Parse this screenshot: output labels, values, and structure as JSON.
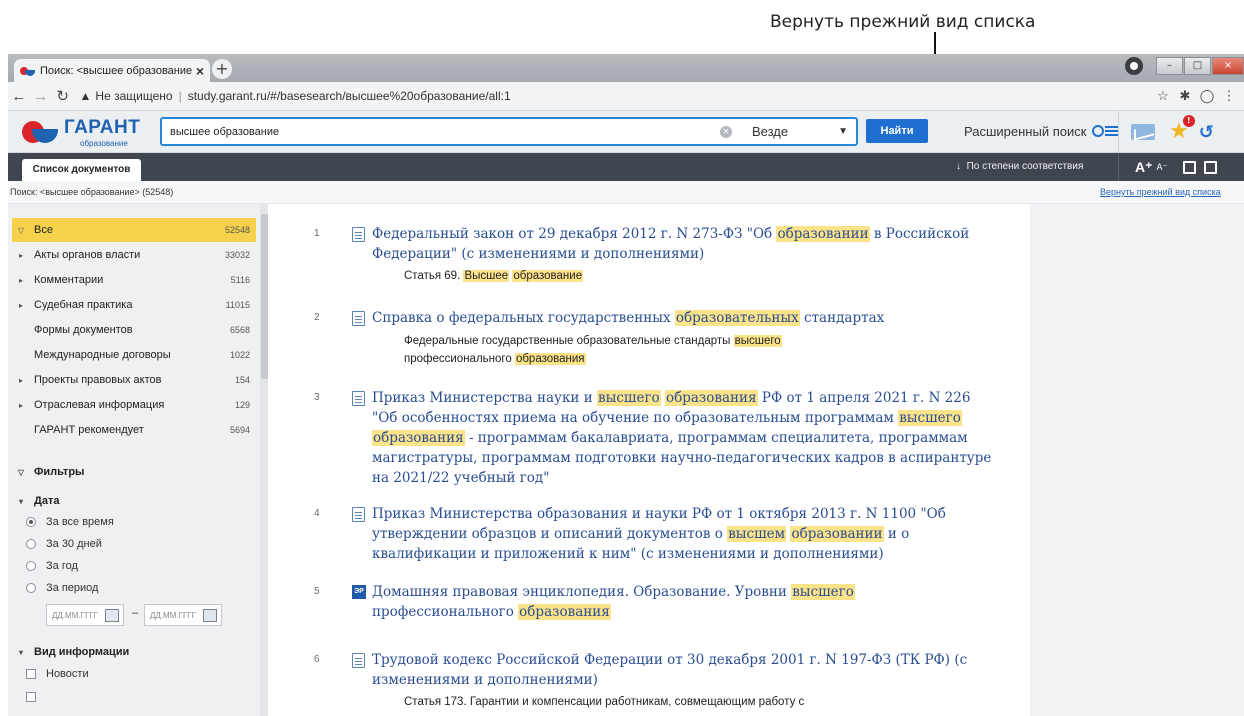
{
  "annotation": {
    "text": "Вернуть прежний вид списка"
  },
  "browser": {
    "tab_title": "Поиск: <высшее образование>",
    "new_tab": "+",
    "close_tab": "×",
    "security": "Не защищено",
    "url": "study.garant.ru/#/basesearch/высшее%20образование/all:1"
  },
  "header": {
    "logo_name": "ГАРАНТ",
    "logo_sub": "образование",
    "search_value": "высшее образование",
    "scope": "Везде",
    "find_button": "Найти",
    "advanced_search": "Расширенный поиск",
    "badge": "!"
  },
  "toolbar": {
    "doc_tab": "Список документов",
    "sort": "По степени соответствия",
    "font_up": "A⁺",
    "font_down": "A⁻"
  },
  "crumb": {
    "text": "Поиск: <высшее образование> (52548)",
    "revert_link": "Вернуть прежний вид списка"
  },
  "sidebar": {
    "categories": [
      {
        "label": "Все",
        "count": "52548"
      },
      {
        "label": "Акты органов власти",
        "count": "33032"
      },
      {
        "label": "Комментарии",
        "count": "5116"
      },
      {
        "label": "Судебная практика",
        "count": "11015"
      },
      {
        "label": "Формы документов",
        "count": "6568"
      },
      {
        "label": "Международные договоры",
        "count": "1022"
      },
      {
        "label": "Проекты правовых актов",
        "count": "154"
      },
      {
        "label": "Отраслевая информация",
        "count": "129"
      },
      {
        "label": "ГАРАНТ рекомендует",
        "count": "5694"
      }
    ],
    "filters_title": "Фильтры",
    "date_title": "Дата",
    "date_options": [
      "За все время",
      "За 30 дней",
      "За год",
      "За период"
    ],
    "date_placeholder": "ДД.ММ.ГГГГ",
    "date_dash": "–",
    "info_title": "Вид информации",
    "info_options": [
      "Новости"
    ]
  },
  "results": [
    {
      "num": "1",
      "title_parts": [
        "Федеральный закон от 29 декабря 2012 г. N 273-ФЗ \"Об ",
        "образовании",
        " в Российской Федерации\" (с изменениями и дополнениями)"
      ],
      "sub_parts": [
        "Статья 69. ",
        "Высшее",
        " ",
        "образование",
        ""
      ]
    },
    {
      "num": "2",
      "title_parts": [
        "Справка о федеральных государственных ",
        "образовательных",
        " стандартах"
      ],
      "sub_parts": [
        "Федеральные государственные образовательные стандарты ",
        "высшего",
        " профессионального ",
        "образования",
        ""
      ]
    },
    {
      "num": "3",
      "title_parts": [
        "Приказ Министерства науки и ",
        "высшего",
        " ",
        "образования",
        " РФ от 1 апреля 2021 г. N 226 \"Об особенностях приема на обучение по образовательным программам ",
        "высшего",
        " ",
        "образования",
        " - программам бакалавриата, программам специалитета, программам магистратуры, программам подготовки научно-педагогических кадров в аспирантуре на 2021/22 учебный год\""
      ]
    },
    {
      "num": "4",
      "title_parts": [
        "Приказ Министерства образования и науки РФ от 1 октября 2013 г. N 1100 \"Об утверждении образцов и описаний документов о ",
        "высшем",
        " ",
        "образовании",
        " и о квалификации и приложений к ним\" (с изменениями и дополнениями)"
      ]
    },
    {
      "num": "5",
      "icon_label": "ЭР",
      "title_parts": [
        "Домашняя правовая энциклопедия. Образование. Уровни ",
        "высшего",
        " профессионального ",
        "образования",
        ""
      ]
    },
    {
      "num": "6",
      "title_parts": [
        "Трудовой кодекс Российской Федерации от 30 декабря 2001 г. N 197-ФЗ (ТК РФ) (с изменениями и дополнениями)"
      ],
      "sub_parts": [
        "Статья 173. Гарантии и компенсации работникам, совмещающим работу с"
      ]
    }
  ]
}
